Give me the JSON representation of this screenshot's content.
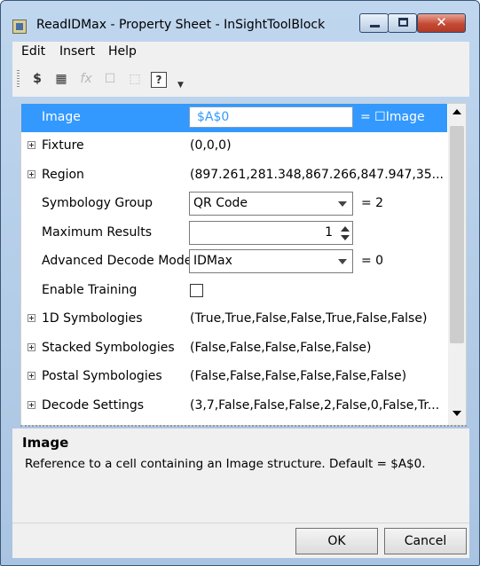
{
  "window": {
    "title": "ReadIDMax - Property Sheet - InSightToolBlock"
  },
  "menu": {
    "items": [
      "Edit",
      "Insert",
      "Help"
    ]
  },
  "toolbar": {
    "buttons": [
      "$",
      "▦",
      "fx",
      "☐",
      "⬚",
      "?"
    ]
  },
  "properties": {
    "image": {
      "label": "Image",
      "value": "$A$0",
      "suffix": "= ☐Image"
    },
    "fixture": {
      "label": "Fixture",
      "value": "(0,0,0)"
    },
    "region": {
      "label": "Region",
      "value": "(897.261,281.348,867.266,847.947,35..."
    },
    "symbology_group": {
      "label": "Symbology Group",
      "value": "QR Code",
      "suffix": "= 2"
    },
    "maximum_results": {
      "label": "Maximum Results",
      "value": "1"
    },
    "advanced_decode_mode": {
      "label": "Advanced Decode Mode",
      "value": "IDMax",
      "suffix": "= 0"
    },
    "enable_training": {
      "label": "Enable Training"
    },
    "symbologies_1d": {
      "label": "1D Symbologies",
      "value": "(True,True,False,False,True,False,False)"
    },
    "stacked_symbologies": {
      "label": "Stacked Symbologies",
      "value": "(False,False,False,False,False)"
    },
    "postal_symbologies": {
      "label": "Postal Symbologies",
      "value": "(False,False,False,False,False,False)"
    },
    "decode_settings": {
      "label": "Decode Settings",
      "value": "(3,7,False,False,False,2,False,0,False,Tr..."
    }
  },
  "description": {
    "title": "Image",
    "text": "Reference to a cell containing an Image structure. Default = $A$0."
  },
  "buttons": {
    "ok": "OK",
    "cancel": "Cancel"
  }
}
